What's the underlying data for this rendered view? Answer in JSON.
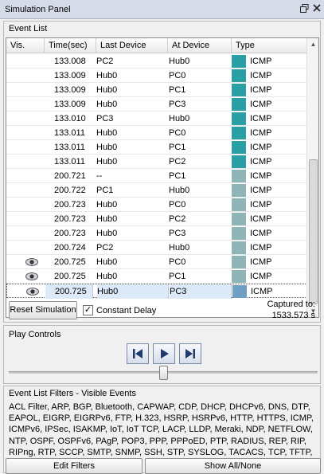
{
  "window": {
    "title": "Simulation Panel",
    "restore_icon": "restore-icon",
    "close_icon": "close-icon"
  },
  "event_list": {
    "label": "Event List",
    "columns": [
      "Vis.",
      "Time(sec)",
      "Last Device",
      "At Device",
      "Type"
    ],
    "rows": [
      {
        "vis": false,
        "time": "133.008",
        "last": "PC2",
        "at": "Hub0",
        "type": "ICMP",
        "color": "#2a9fa6"
      },
      {
        "vis": false,
        "time": "133.009",
        "last": "Hub0",
        "at": "PC0",
        "type": "ICMP",
        "color": "#2a9fa6"
      },
      {
        "vis": false,
        "time": "133.009",
        "last": "Hub0",
        "at": "PC1",
        "type": "ICMP",
        "color": "#2a9fa6"
      },
      {
        "vis": false,
        "time": "133.009",
        "last": "Hub0",
        "at": "PC3",
        "type": "ICMP",
        "color": "#2a9fa6"
      },
      {
        "vis": false,
        "time": "133.010",
        "last": "PC3",
        "at": "Hub0",
        "type": "ICMP",
        "color": "#2a9fa6"
      },
      {
        "vis": false,
        "time": "133.011",
        "last": "Hub0",
        "at": "PC0",
        "type": "ICMP",
        "color": "#2a9fa6"
      },
      {
        "vis": false,
        "time": "133.011",
        "last": "Hub0",
        "at": "PC1",
        "type": "ICMP",
        "color": "#2a9fa6"
      },
      {
        "vis": false,
        "time": "133.011",
        "last": "Hub0",
        "at": "PC2",
        "type": "ICMP",
        "color": "#2a9fa6"
      },
      {
        "vis": false,
        "time": "200.721",
        "last": "--",
        "at": "PC1",
        "type": "ICMP",
        "color": "#8fb5b8"
      },
      {
        "vis": false,
        "time": "200.722",
        "last": "PC1",
        "at": "Hub0",
        "type": "ICMP",
        "color": "#8fb5b8"
      },
      {
        "vis": false,
        "time": "200.723",
        "last": "Hub0",
        "at": "PC0",
        "type": "ICMP",
        "color": "#8fb5b8"
      },
      {
        "vis": false,
        "time": "200.723",
        "last": "Hub0",
        "at": "PC2",
        "type": "ICMP",
        "color": "#8fb5b8"
      },
      {
        "vis": false,
        "time": "200.723",
        "last": "Hub0",
        "at": "PC3",
        "type": "ICMP",
        "color": "#8fb5b8"
      },
      {
        "vis": false,
        "time": "200.724",
        "last": "PC2",
        "at": "Hub0",
        "type": "ICMP",
        "color": "#8fb5b8"
      },
      {
        "vis": true,
        "time": "200.725",
        "last": "Hub0",
        "at": "PC0",
        "type": "ICMP",
        "color": "#8fb5b8"
      },
      {
        "vis": true,
        "time": "200.725",
        "last": "Hub0",
        "at": "PC1",
        "type": "ICMP",
        "color": "#8fb5b8"
      },
      {
        "vis": true,
        "time": "200.725",
        "last": "Hub0",
        "at": "PC3",
        "type": "ICMP",
        "color": "#6f9fc3",
        "selected": true
      }
    ],
    "reset_label": "Reset Simulation",
    "constant_delay_label": "Constant Delay",
    "constant_delay_checked": true,
    "captured_label": "Captured to:",
    "captured_value": "1533.573 s"
  },
  "play_controls": {
    "label": "Play Controls",
    "back_icon": "step-back-icon",
    "play_icon": "play-icon",
    "forward_icon": "step-forward-icon",
    "slider_value_fraction": 0.5
  },
  "filters": {
    "label": "Event List Filters - Visible Events",
    "text": "ACL Filter, ARP, BGP, Bluetooth, CAPWAP, CDP, DHCP, DHCPv6, DNS, DTP, EAPOL, EIGRP, EIGRPv6, FTP, H.323, HSRP, HSRPv6, HTTP, HTTPS, ICMP, ICMPv6, IPSec, ISAKMP, IoT, IoT TCP, LACP, LLDP, Meraki, NDP, NETFLOW, NTP, OSPF, OSPFv6, PAgP, POP3, PPP, PPPoED, PTP, RADIUS, REP, RIP, RIPng, RTP, SCCP, SMTP, SNMP, SSH, STP, SYSLOG, TACACS, TCP, TFTP, Telnet, UDP, USB, VTP",
    "edit_label": "Edit Filters",
    "show_all_label": "Show All/None"
  }
}
